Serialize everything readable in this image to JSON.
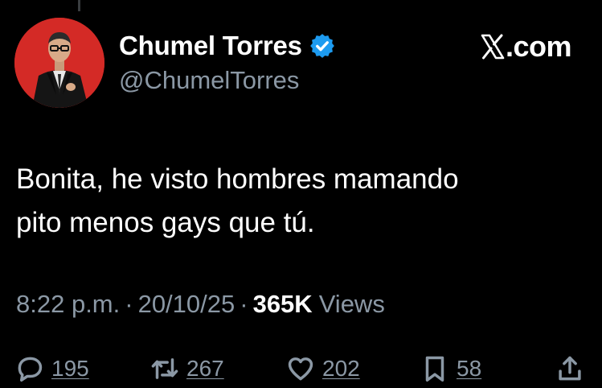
{
  "tweet": {
    "author": {
      "display_name": "Chumel Torres",
      "handle": "@ChumelTorres",
      "verified": true,
      "avatar_bg": "#d42a26"
    },
    "brand": {
      "label": ".com",
      "icon": "x-logo-icon"
    },
    "text_lines": [
      "Bonita, he visto hombres mamando",
      "pito menos gays que tú."
    ],
    "meta": {
      "time": "8:22 p.m.",
      "separator": "·",
      "date": "20/10/25",
      "views_count": "365K",
      "views_label": "Views"
    },
    "actions": {
      "replies": {
        "icon": "reply-icon",
        "count": "195"
      },
      "reposts": {
        "icon": "repost-icon",
        "count": "267"
      },
      "likes": {
        "icon": "heart-icon",
        "count": "202"
      },
      "bookmarks": {
        "icon": "bookmark-icon",
        "count": "58"
      },
      "share": {
        "icon": "share-icon"
      }
    }
  },
  "colors": {
    "background": "#000000",
    "primary_text": "#ffffff",
    "secondary_text": "#8b98a5",
    "verified_blue": "#1d9bf0"
  }
}
